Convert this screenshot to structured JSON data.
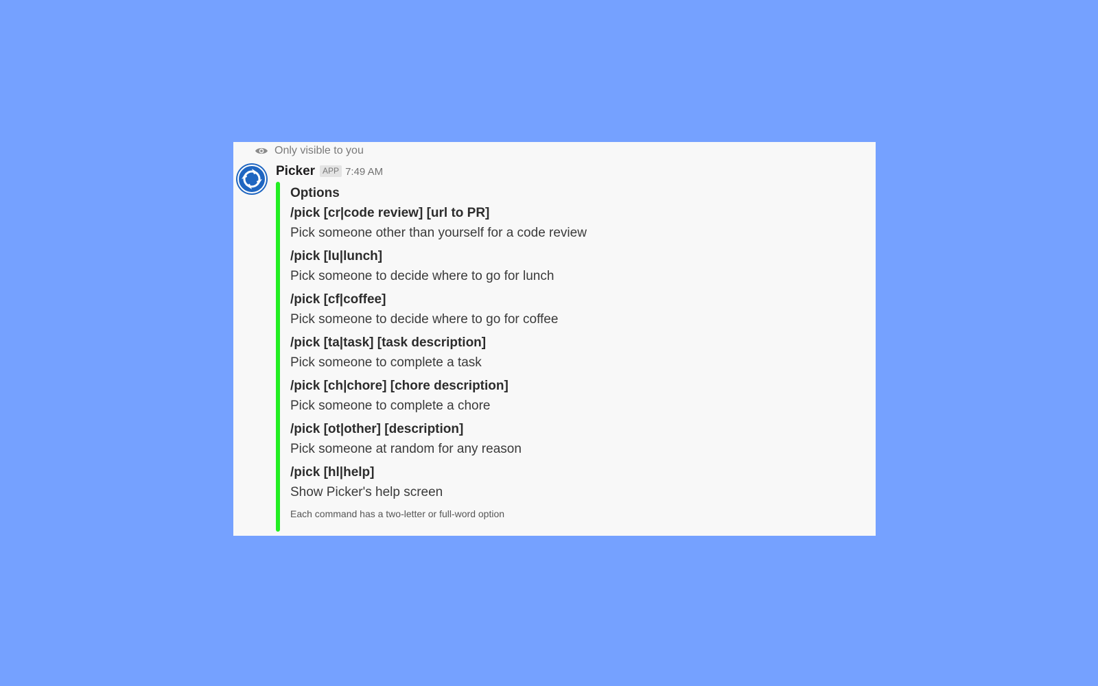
{
  "visibility_note": "Only visible to you",
  "message": {
    "sender": "Picker",
    "badge": "APP",
    "time": "7:49 AM"
  },
  "attachment": {
    "accent_color": "#22ee22",
    "title": "Options",
    "commands": [
      {
        "command": "/pick [cr|code review] [url to PR]",
        "description": "Pick someone other than yourself for a code review"
      },
      {
        "command": "/pick [lu|lunch]",
        "description": "Pick someone to decide where to go for lunch"
      },
      {
        "command": "/pick [cf|coffee]",
        "description": "Pick someone to decide where to go for coffee"
      },
      {
        "command": "/pick [ta|task] [task description]",
        "description": "Pick someone to complete a task"
      },
      {
        "command": "/pick [ch|chore] [chore description]",
        "description": "Pick someone to complete a chore"
      },
      {
        "command": "/pick [ot|other] [description]",
        "description": "Pick someone at random for any reason"
      },
      {
        "command": "/pick [hl|help]",
        "description": "Show Picker's help screen"
      }
    ],
    "footer": "Each command has a two-letter or full-word option"
  },
  "icons": {
    "visibility": "eye-icon",
    "avatar": "picker-app-avatar"
  },
  "colors": {
    "background": "#75a1ff",
    "card": "#f8f8f8",
    "avatar": "#1f66c1"
  }
}
